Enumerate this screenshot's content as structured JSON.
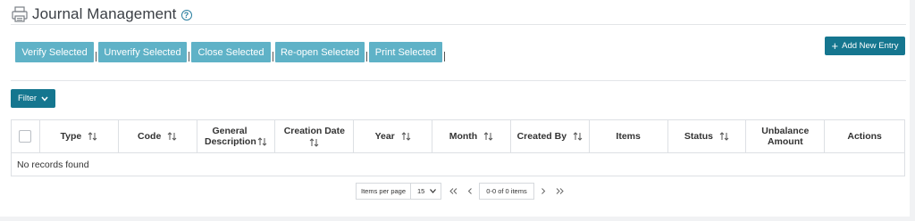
{
  "header": {
    "title": "Journal Management",
    "help_glyph": "?"
  },
  "bulk_actions": [
    {
      "label": "Verify Selected"
    },
    {
      "label": "Unverify Selected"
    },
    {
      "label": "Close Selected"
    },
    {
      "label": "Re-open Selected"
    },
    {
      "label": "Print Selected"
    }
  ],
  "add_button": {
    "label": "Add New Entry",
    "icon": "plus-icon"
  },
  "filter_button": {
    "label": "Filter",
    "icon": "chevron-down-icon"
  },
  "table": {
    "columns": [
      {
        "label": "Type",
        "sortable": true
      },
      {
        "label": "Code",
        "sortable": true
      },
      {
        "label": "General Description",
        "sortable": true
      },
      {
        "label": "Creation Date",
        "sortable": true
      },
      {
        "label": "Year",
        "sortable": true
      },
      {
        "label": "Month",
        "sortable": true
      },
      {
        "label": "Created By",
        "sortable": true
      },
      {
        "label": "Items",
        "sortable": false
      },
      {
        "label": "Status",
        "sortable": true
      },
      {
        "label": "Unbalance Amount",
        "sortable": false
      },
      {
        "label": "Actions",
        "sortable": false
      }
    ],
    "empty_message": "No records found"
  },
  "paginator": {
    "items_per_page_label": "Items per page",
    "page_size": "15",
    "range_label": "0-0 of 0 items"
  },
  "colors": {
    "bulk_button": "#5fb2c7",
    "primary": "#15768f",
    "border": "#dde0e4"
  }
}
